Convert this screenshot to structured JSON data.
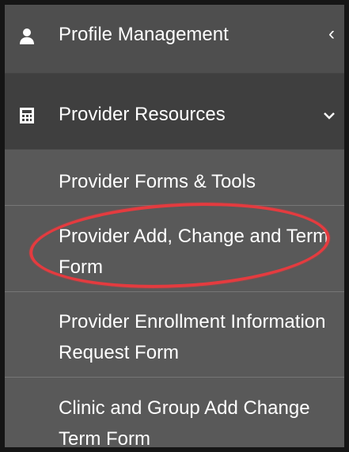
{
  "menu": {
    "profile_management": {
      "label": "Profile Management",
      "icon": "user-icon",
      "chevron": "‹"
    },
    "provider_resources": {
      "label": "Provider Resources",
      "icon": "calculator-icon",
      "chevron": "chevron-down-icon"
    }
  },
  "submenu": {
    "items": [
      {
        "label": "Provider Forms & Tools"
      },
      {
        "label": "Provider Add, Change and Term Form"
      },
      {
        "label": "Provider Enrollment Information Request Form"
      },
      {
        "label": "Clinic and Group Add Change Term Form"
      }
    ]
  },
  "colors": {
    "highlight": "#e43b3f",
    "menu_background": "#4e4e4e",
    "active_menu": "#3f3f3f",
    "submenu_background": "#595959"
  }
}
